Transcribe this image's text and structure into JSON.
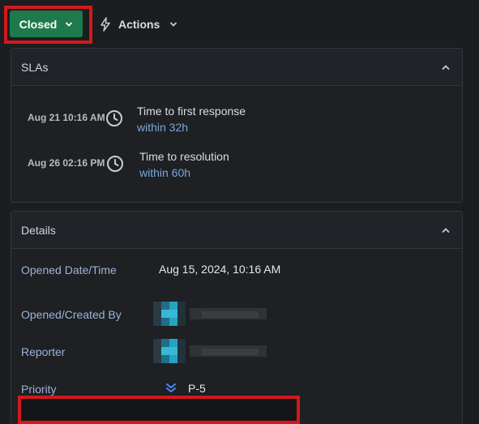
{
  "toolbar": {
    "status_label": "Closed",
    "actions_label": "Actions"
  },
  "sla": {
    "title": "SLAs",
    "items": [
      {
        "date": "Aug 21 10:16 AM",
        "label": "Time to first response",
        "target": "within 32h"
      },
      {
        "date": "Aug 26 02:16 PM",
        "label": "Time to resolution",
        "target": "within 60h"
      }
    ]
  },
  "details": {
    "title": "Details",
    "opened_label": "Opened Date/Time",
    "opened_value": "Aug 15, 2024, 10:16 AM",
    "created_by_label": "Opened/Created By",
    "reporter_label": "Reporter",
    "priority_label": "Priority",
    "priority_value": "P-5"
  },
  "colors": {
    "status_green": "#1e7a4d",
    "highlight_red": "#d11a1a",
    "link_blue": "#7aa7d8",
    "priority_blue": "#4c8bf5"
  }
}
